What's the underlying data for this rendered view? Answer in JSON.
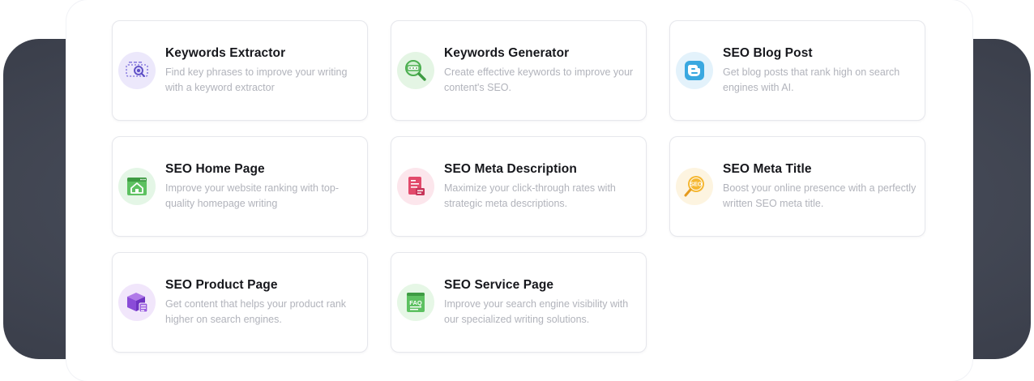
{
  "tools": [
    {
      "title": "Keywords Extractor",
      "description": "Find key phrases to improve your writing with a keyword extractor",
      "icon": "keyword-extractor-icon",
      "icon_bg": "#ece8fb"
    },
    {
      "title": "Keywords Generator",
      "description": "Create effective keywords to improve your content's SEO.",
      "icon": "keyword-generator-icon",
      "icon_bg": "#e4f5e4"
    },
    {
      "title": "SEO Blog Post",
      "description": "Get blog posts that rank high on search engines with AI.",
      "icon": "blog-icon",
      "icon_bg": "#e3f2fb"
    },
    {
      "title": "SEO Home Page",
      "description": "Improve your website ranking with top-quality homepage writing",
      "icon": "home-page-icon",
      "icon_bg": "#e4f6e6"
    },
    {
      "title": "SEO Meta Description",
      "description": "Maximize your click-through rates with strategic meta descriptions.",
      "icon": "meta-description-icon",
      "icon_bg": "#fce6ec"
    },
    {
      "title": "SEO Meta Title",
      "description": "Boost your online presence with a perfectly written SEO meta title.",
      "icon": "seo-badge-icon",
      "icon_bg": "#fdf4e0",
      "icon_text": "SEO"
    },
    {
      "title": "SEO Product Page",
      "description": "Get content that helps your product rank higher on search engines.",
      "icon": "product-box-icon",
      "icon_bg": "#f1e6fb"
    },
    {
      "title": "SEO Service Page",
      "description": "Improve your search engine visibility with our specialized writing solutions.",
      "icon": "faq-icon",
      "icon_bg": "#e6f7e6",
      "icon_text": "FAQ"
    }
  ]
}
